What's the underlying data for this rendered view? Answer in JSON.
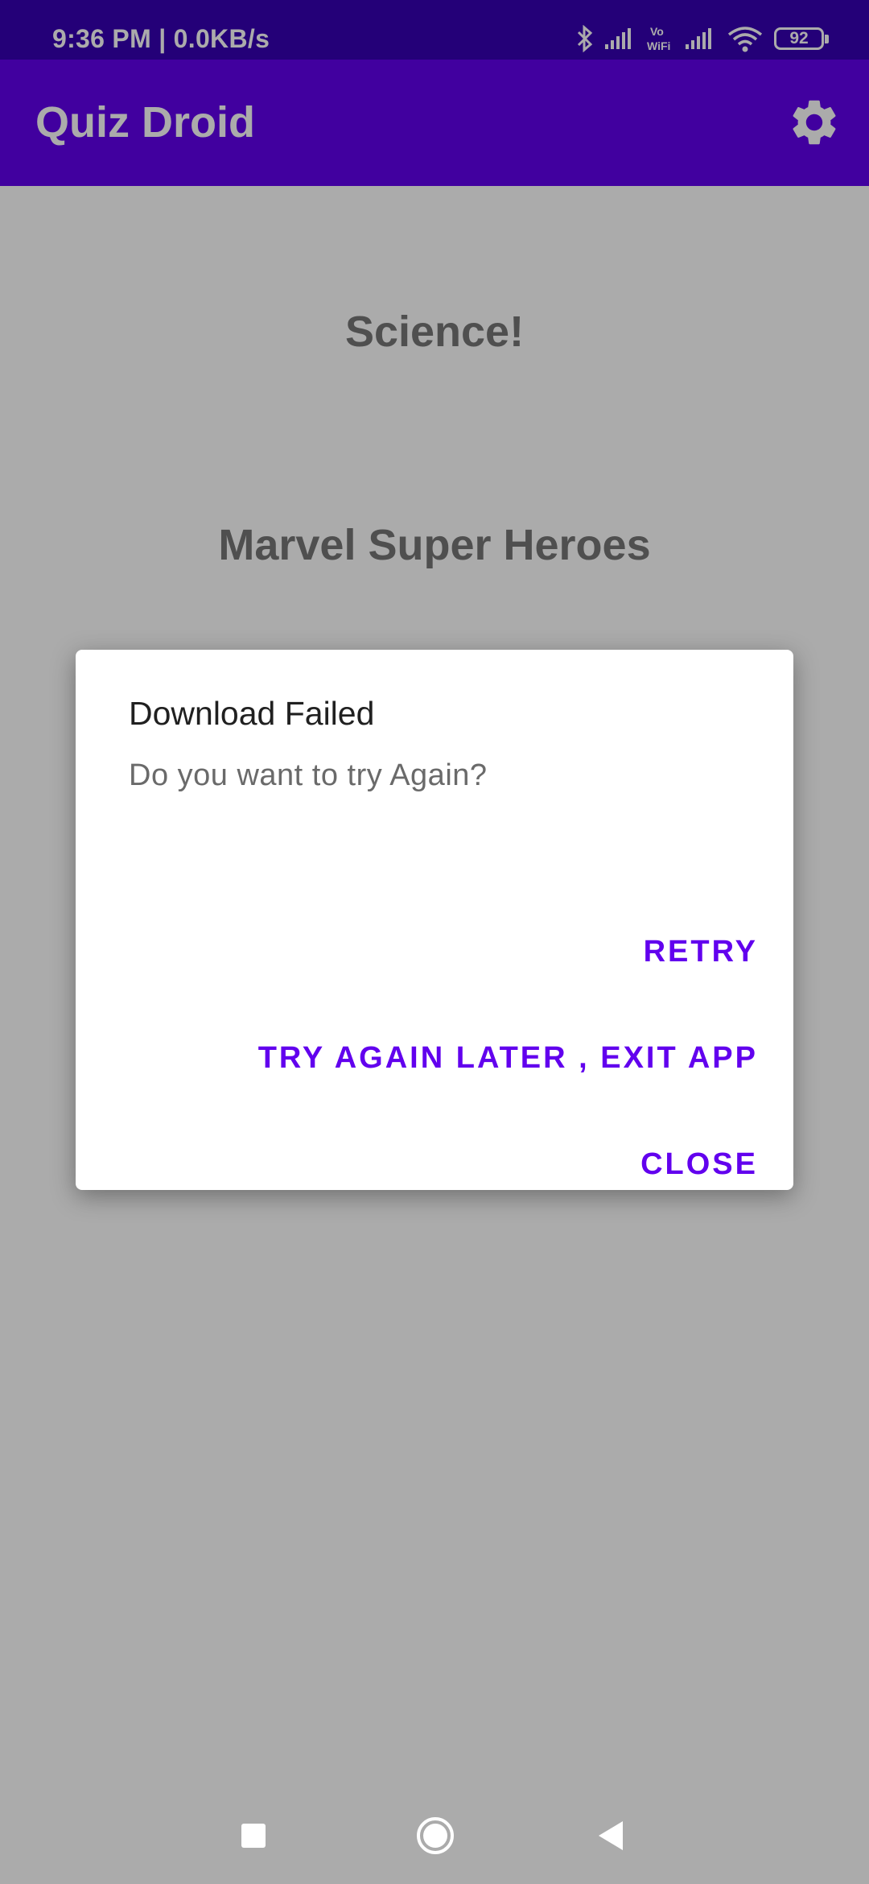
{
  "status_bar": {
    "time": "9:36 PM | 0.0KB/s",
    "battery": "92",
    "icons": [
      "bluetooth-icon",
      "signal-icon",
      "vowifi-icon",
      "signal-icon",
      "wifi-icon",
      "battery-icon"
    ],
    "vowifi_label_top": "Vo",
    "vowifi_label_bottom": "WiFi"
  },
  "app_bar": {
    "title": "Quiz Droid",
    "settings_icon": "gear-icon"
  },
  "categories": [
    {
      "label": "Science!"
    },
    {
      "label": "Marvel Super Heroes"
    }
  ],
  "dialog": {
    "title": "Download Failed",
    "message": "Do you want to try Again?",
    "buttons": {
      "retry": "RETRY",
      "later": "TRY AGAIN LATER , EXIT APP",
      "close": "CLOSE"
    }
  },
  "nav_bar": {
    "icons": [
      "recents-icon",
      "home-icon",
      "back-icon"
    ]
  },
  "colors": {
    "status_bar": "#3700b3",
    "primary": "#6200ee",
    "accent_text": "#6200ee"
  }
}
